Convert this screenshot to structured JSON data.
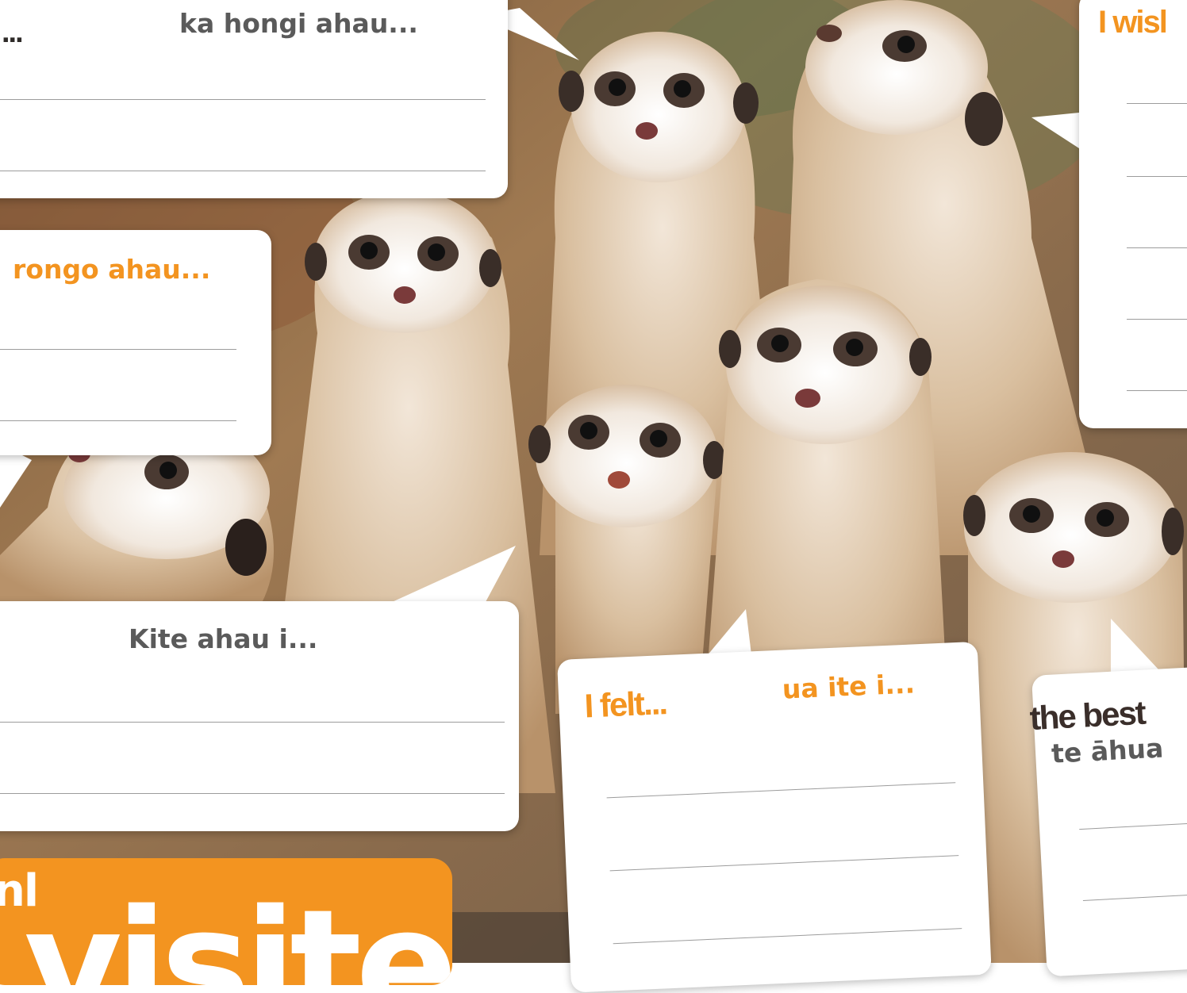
{
  "colors": {
    "accent_orange": "#f39420",
    "label_grey": "#5a5a5a",
    "bubble_white": "#ffffff",
    "write_line": "#9c9c9c"
  },
  "bubbles": {
    "smell": {
      "english": "...",
      "maori": "ka hongi ahau..."
    },
    "hear": {
      "maori": "rongo ahau..."
    },
    "see": {
      "maori": "Kite ahau i..."
    },
    "felt": {
      "english": "I felt...",
      "maori": "ua ite i..."
    },
    "wish": {
      "english": "I wisl"
    },
    "best": {
      "english": "the best",
      "maori": "te āhua"
    }
  },
  "banner": {
    "small_text": "nl",
    "big_text": "visited"
  },
  "photo": {
    "subject_icon": "meerkat-group-photo"
  }
}
